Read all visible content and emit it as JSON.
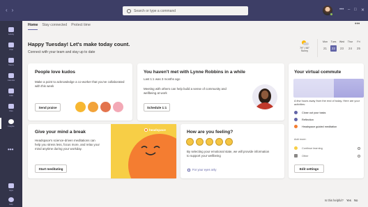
{
  "titlebar": {
    "search_placeholder": "Search or type a command",
    "back_glyph": "‹",
    "forward_glyph": "›",
    "minimize_glyph": "–",
    "maximize_glyph": "□",
    "close_glyph": "✕"
  },
  "rail": {
    "items": [
      {
        "label": "Activity",
        "icon": "bell-icon"
      },
      {
        "label": "Chat",
        "icon": "chat-icon"
      },
      {
        "label": "Teams",
        "icon": "teams-icon"
      },
      {
        "label": "Calendar",
        "icon": "calendar-icon"
      },
      {
        "label": "Calls",
        "icon": "phone-icon"
      },
      {
        "label": "Files",
        "icon": "file-icon"
      },
      {
        "label": "Insights",
        "icon": "insights-icon"
      }
    ],
    "more_glyph": "•••",
    "bottom_items": [
      {
        "label": "Apps",
        "icon": "apps-icon"
      },
      {
        "label": "Help",
        "icon": "help-icon"
      }
    ]
  },
  "tabs": [
    {
      "label": "Home",
      "active": true
    },
    {
      "label": "Stay connected",
      "active": false
    },
    {
      "label": "Protect time",
      "active": false
    }
  ],
  "more_glyph": "•••",
  "greeting": {
    "title": "Happy Tuesday! Let's make today count.",
    "subtitle": "Connect with your team and stay up to date"
  },
  "weather": {
    "temp": "79° | 56°",
    "condition": "Sunny",
    "icon": "partly-sunny-icon"
  },
  "calendar": {
    "days": [
      {
        "name": "Mon",
        "num": "21"
      },
      {
        "name": "Tues",
        "num": "22",
        "today": true
      },
      {
        "name": "Wed",
        "num": "23"
      },
      {
        "name": "Thur",
        "num": "24"
      },
      {
        "name": "Fri",
        "num": "25"
      }
    ]
  },
  "kudos": {
    "title": "People love kudos",
    "text": "Make a point to acknowledge a co-worker that you've collaborated with this week",
    "button": "Send praise"
  },
  "lynne": {
    "title": "You haven't met with Lynne Robbins in a while",
    "last": "Last 1:1 was 3 months ago",
    "text": "Meeting with others can help build a sense of community and wellbeing at work",
    "button": "Schedule 1:1"
  },
  "commute": {
    "title": "Your virtual commute",
    "text": "A few hours away from the end of today. Here are your activities:",
    "activities": [
      {
        "label": "Close out your tasks",
        "color": "#6264a7"
      },
      {
        "label": "Reflection",
        "color": "#6264a7"
      },
      {
        "label": "Headspace guided meditation",
        "color": "#f47d31"
      }
    ],
    "add_more": "Add more:",
    "more": [
      {
        "label": "Continue learning"
      },
      {
        "label": "Other"
      }
    ],
    "button": "Edit settings"
  },
  "mind": {
    "title": "Give your mind a break",
    "text": "Headspace's science-driven meditations can help you stress less, focus more, and relax your mind anytime during your workday.",
    "button": "Start meditating",
    "brand": "headspace"
  },
  "feeling": {
    "title": "How are you feeling?",
    "emojis": [
      "grinning-face-icon",
      "smiling-face-icon",
      "neutral-face-icon",
      "frowning-face-icon",
      "sad-face-icon"
    ],
    "text": "By selecting your emotional state, we will provide information to support your wellbeing",
    "privacy": "For your eyes only"
  },
  "helpful": {
    "question": "Is this helpful?",
    "yes": "Yes",
    "no": "No"
  },
  "colors": {
    "accent": "#6264a7",
    "titlebar": "#3d3e66",
    "rail": "#33344a",
    "headspace_orange": "#f47d31",
    "headspace_yellow": "#f7ce46"
  }
}
